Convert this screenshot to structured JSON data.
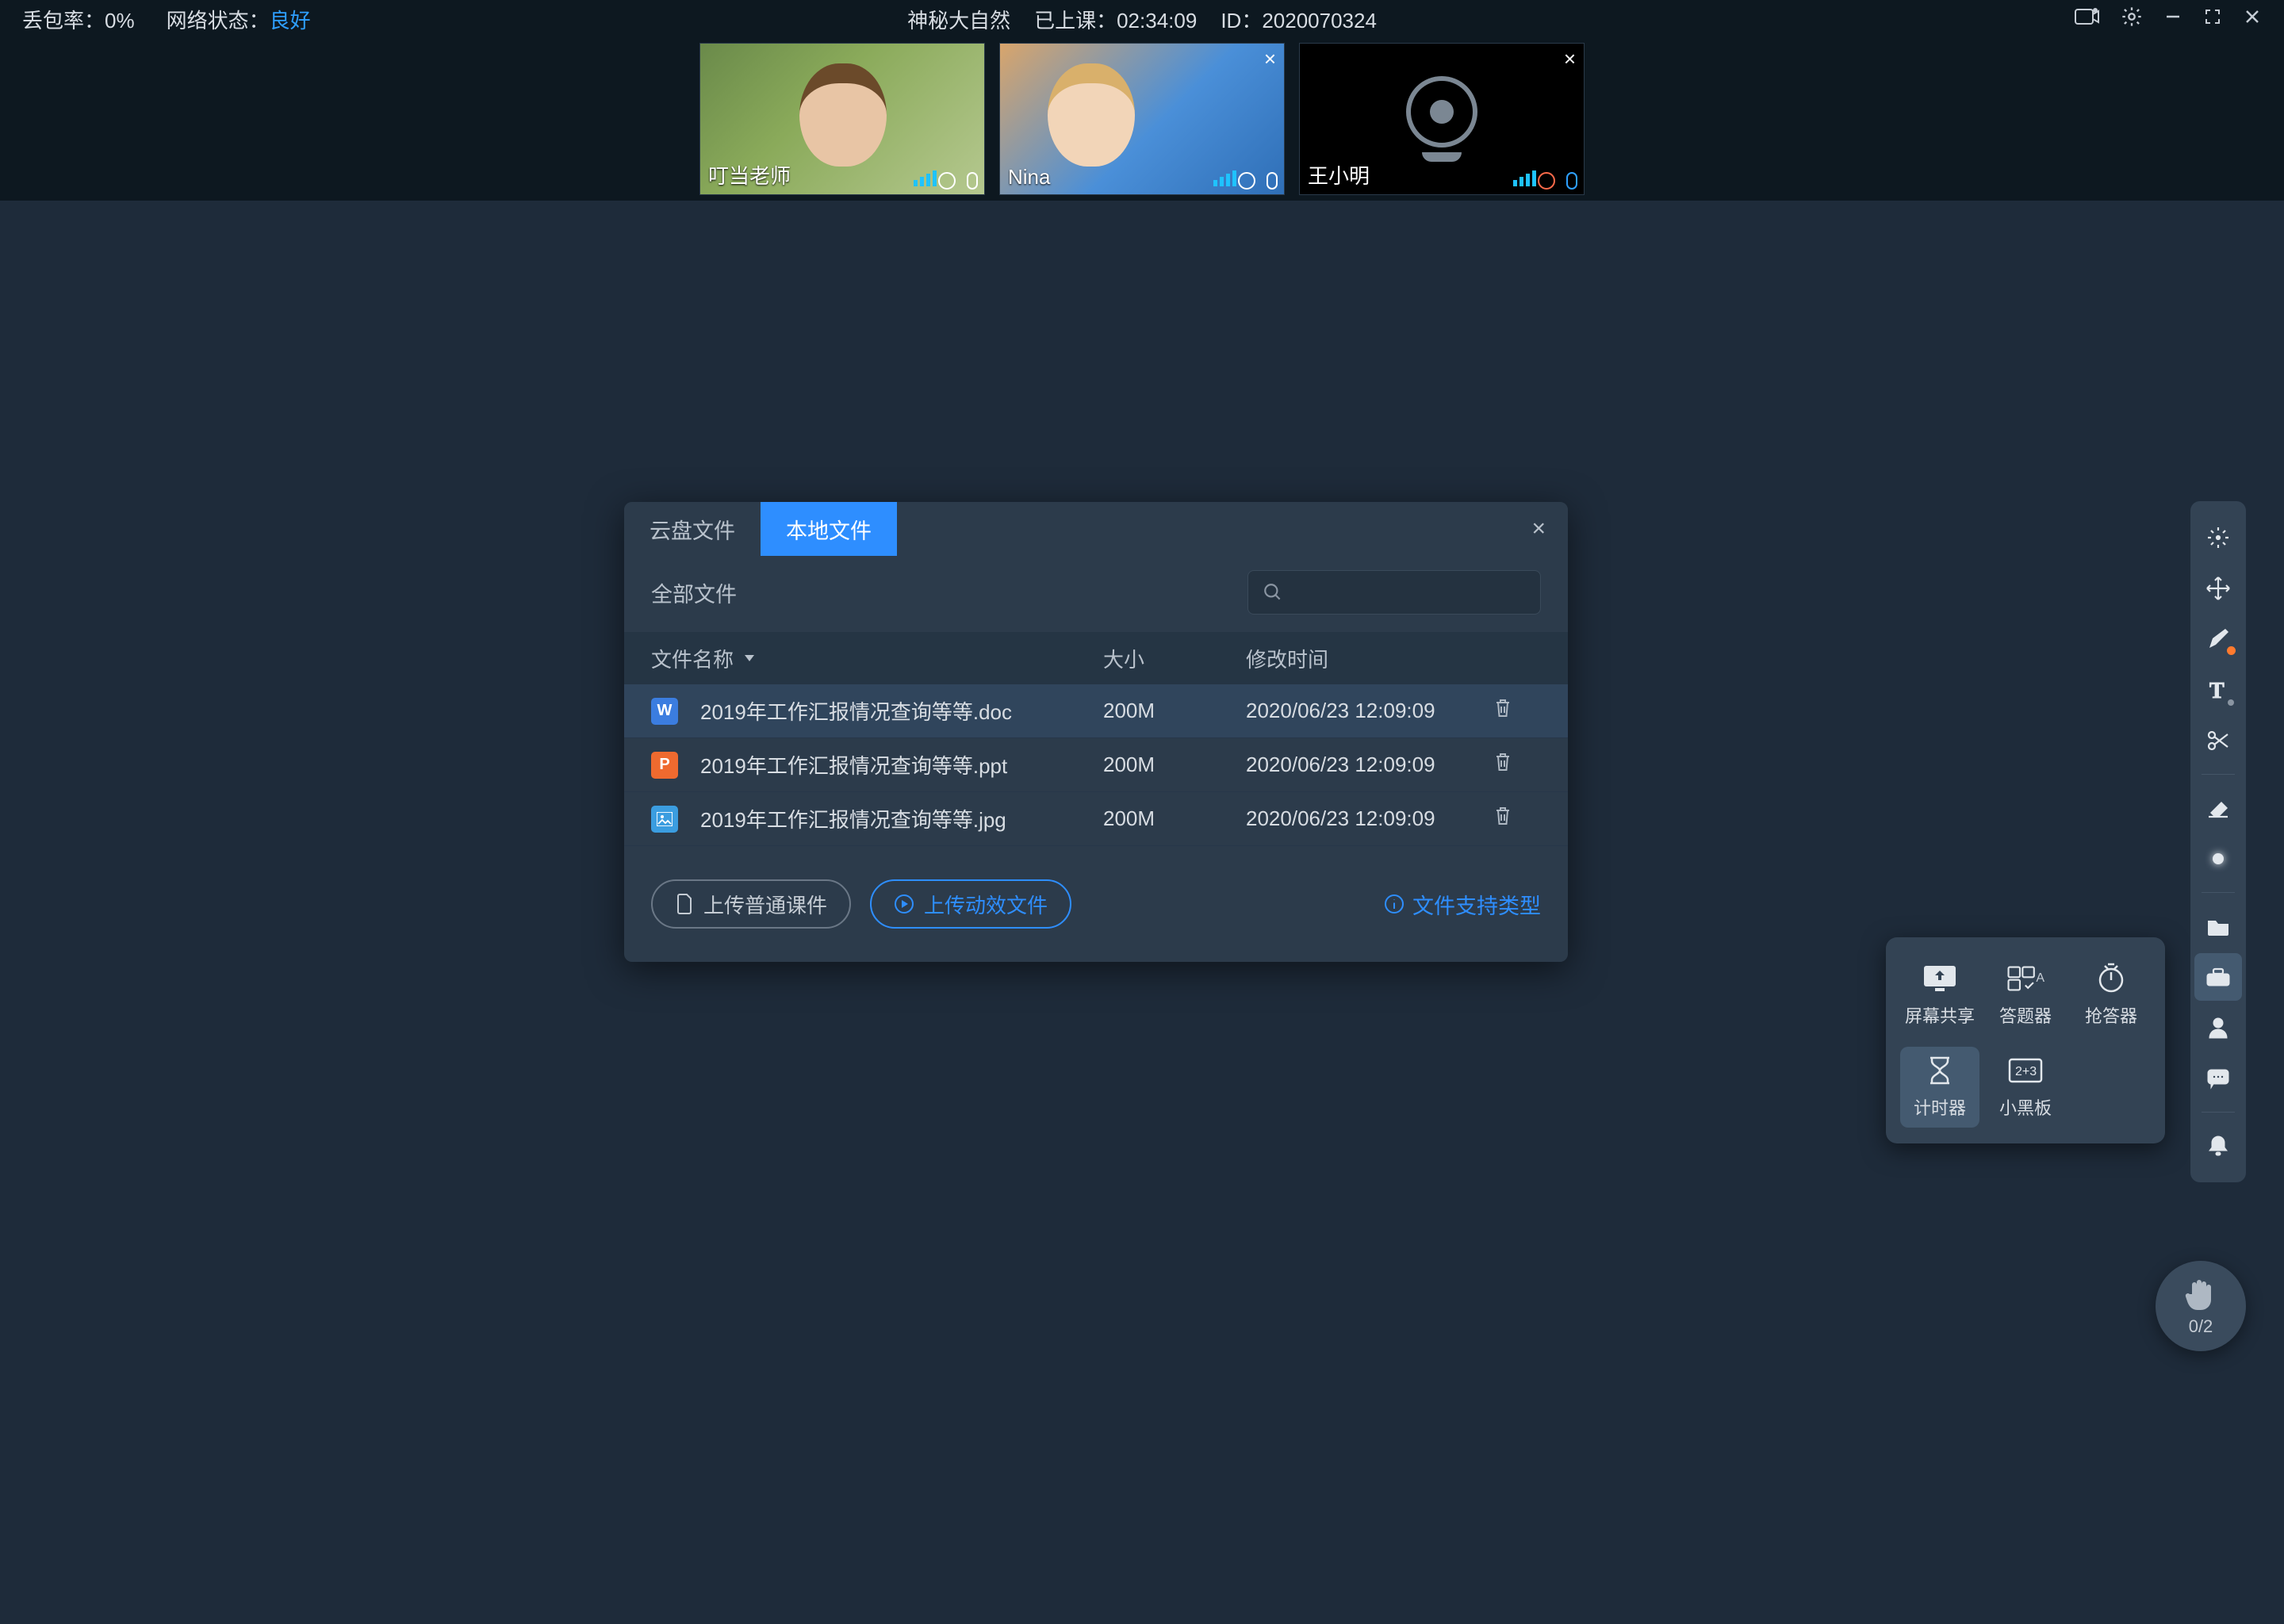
{
  "topbar": {
    "packet_loss_label": "丢包率：",
    "packet_loss_value": "0%",
    "network_label": "网络状态：",
    "network_value": "良好",
    "course_title": "神秘大自然",
    "elapsed_label": "已上课：",
    "elapsed_value": "02:34:09",
    "id_label": "ID：",
    "id_value": "2020070324"
  },
  "videos": [
    {
      "name": "叮当老师",
      "kind": "teacher",
      "closable": false,
      "muted": false
    },
    {
      "name": "Nina",
      "kind": "nina",
      "closable": true,
      "muted": false
    },
    {
      "name": "王小明",
      "kind": "camoff",
      "closable": true,
      "muted": true
    }
  ],
  "dialog": {
    "tab_cloud": "云盘文件",
    "tab_local": "本地文件",
    "all_files": "全部文件",
    "col_name": "文件名称",
    "col_size": "大小",
    "col_time": "修改时间",
    "files": [
      {
        "icon": "word",
        "letter": "W",
        "name": "2019年工作汇报情况查询等等.doc",
        "size": "200M",
        "time": "2020/06/23 12:09:09"
      },
      {
        "icon": "ppt",
        "letter": "P",
        "name": "2019年工作汇报情况查询等等.ppt",
        "size": "200M",
        "time": "2020/06/23 12:09:09"
      },
      {
        "icon": "img",
        "letter": "",
        "name": "2019年工作汇报情况查询等等.jpg",
        "size": "200M",
        "time": "2020/06/23 12:09:09"
      }
    ],
    "btn_upload_normal": "上传普通课件",
    "btn_upload_anim": "上传动效文件",
    "support_types": "文件支持类型"
  },
  "toolbox": {
    "screen_share": "屏幕共享",
    "answer": "答题器",
    "responder": "抢答器",
    "timer": "计时器",
    "blackboard": "小黑板"
  },
  "hand": {
    "count": "0/2"
  }
}
